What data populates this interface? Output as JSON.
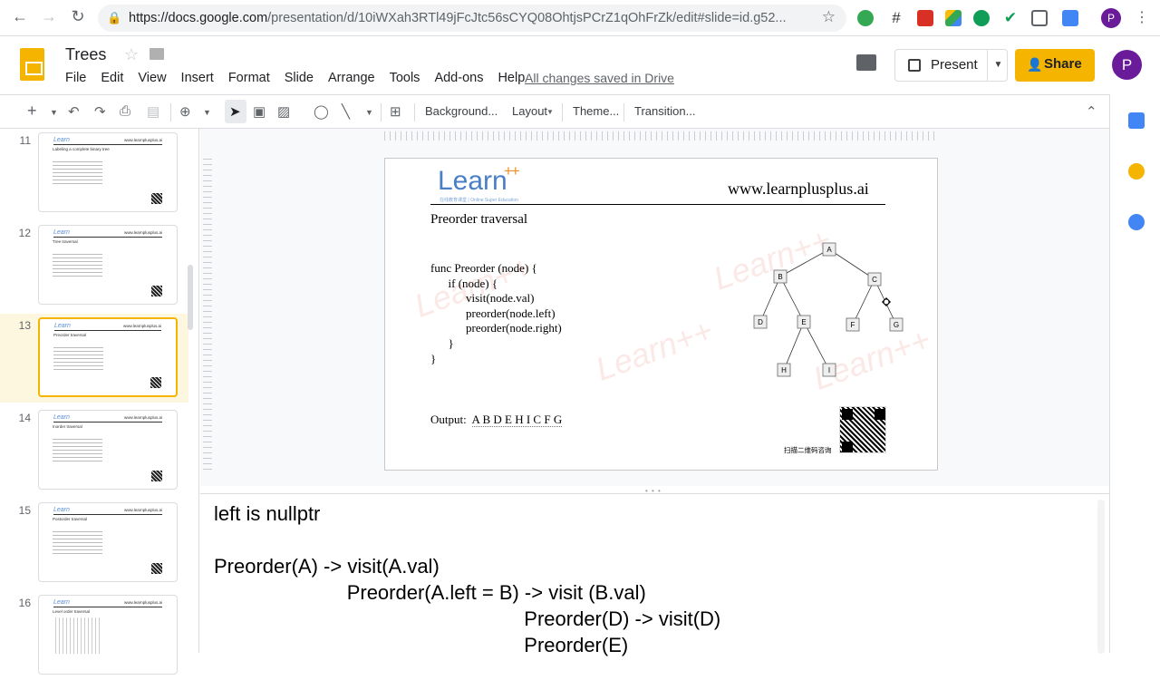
{
  "browser": {
    "url_base": "https://docs.google.com",
    "url_path": "/presentation/d/10iWXah3RTl49jFcJtc56sCYQ08OhtjsPCrZ1qOhFrZk/edit#slide=id.g52...",
    "avatar_letter": "P"
  },
  "doc": {
    "title": "Trees",
    "menu": [
      "File",
      "Edit",
      "View",
      "Insert",
      "Format",
      "Slide",
      "Arrange",
      "Tools",
      "Add-ons",
      "Help"
    ],
    "saved_status": "All changes saved in Drive",
    "present_label": "Present",
    "share_label": "Share",
    "avatar_letter": "P"
  },
  "toolbar": {
    "background": "Background...",
    "layout": "Layout",
    "theme": "Theme...",
    "transition": "Transition..."
  },
  "filmstrip": {
    "selected": "13",
    "slides": [
      {
        "num": "11",
        "title": "Labeling a complete binary tree"
      },
      {
        "num": "12",
        "title": "Tree traversal"
      },
      {
        "num": "13",
        "title": "Preorder traversal"
      },
      {
        "num": "14",
        "title": "Inorder traversal"
      },
      {
        "num": "15",
        "title": "Postorder traversal"
      },
      {
        "num": "16",
        "title": "Level order traversal"
      }
    ]
  },
  "slide": {
    "logo_text": "Learn",
    "logo_plus": "++",
    "logo_sub": "在线教育课堂 | Online Super Education",
    "site": "www.learnplusplus.ai",
    "title": "Preorder traversal",
    "code": "func Preorder (node) {\n      if (node) {\n            visit(node.val)\n            preorder(node.left)\n            preorder(node.right)\n      }\n}",
    "output_label": "Output:",
    "output_value": "A B D E H I C F G",
    "qr_caption": "扫描二维码咨询",
    "tree_nodes": [
      "A",
      "B",
      "C",
      "D",
      "E",
      "F",
      "G",
      "H",
      "I"
    ],
    "watermark": "Learn++"
  },
  "notes": {
    "text": "left is nullptr\n\nPreorder(A) -> visit(A.val)\n                        Preorder(A.left = B) -> visit (B.val)\n                                                        Preorder(D) -> visit(D)\n                                                        Preorder(E)"
  }
}
